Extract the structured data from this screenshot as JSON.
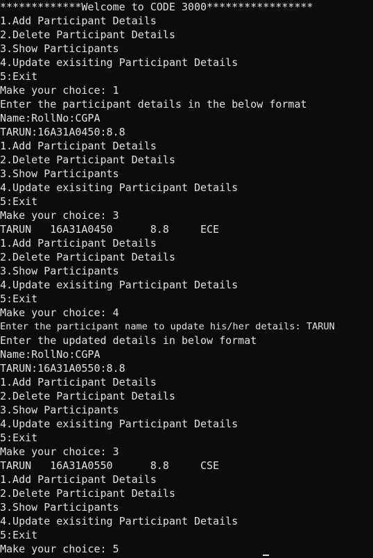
{
  "terminal": {
    "lines": [
      "*************Welcome to CODE 3000*****************",
      "1.Add Participant Details",
      "2.Delete Participant Details",
      "3.Show Participants",
      "4.Update exisiting Participant Details",
      "5:Exit",
      "Make your choice: 1",
      "Enter the participant details in the below format",
      "Name:RollNo:CGPA",
      "TARUN:16A31A0450:8.8",
      "1.Add Participant Details",
      "2.Delete Participant Details",
      "3.Show Participants",
      "4.Update exisiting Participant Details",
      "5:Exit",
      "Make your choice: 3",
      "TARUN   16A31A0450      8.8     ECE",
      "1.Add Participant Details",
      "2.Delete Participant Details",
      "3.Show Participants",
      "4.Update exisiting Participant Details",
      "5:Exit",
      "Make your choice: 4",
      "Enter the participant name to update his/her details: TARUN",
      "Enter the updated details in below format",
      "Name:RollNo:CGPA",
      "TARUN:16A31A0550:8.8",
      "1.Add Participant Details",
      "2.Delete Participant Details",
      "3.Show Participants",
      "4.Update exisiting Participant Details",
      "5:Exit",
      "Make your choice: 3",
      "TARUN   16A31A0550      8.8     CSE",
      "1.Add Participant Details",
      "2.Delete Participant Details",
      "3.Show Participants",
      "4.Update exisiting Participant Details",
      "5:Exit",
      "Make your choice: 5"
    ]
  }
}
